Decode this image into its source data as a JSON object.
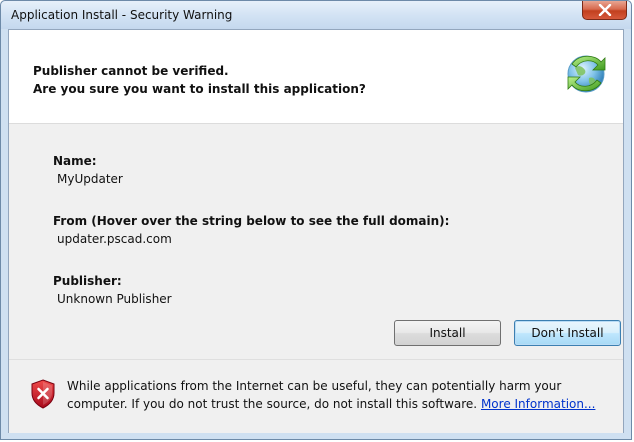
{
  "window": {
    "title": "Application Install - Security Warning"
  },
  "header": {
    "line1": "Publisher cannot be verified.",
    "line2": "Are you sure you want to install this application?"
  },
  "fields": {
    "name_label": "Name:",
    "name_value": "MyUpdater",
    "from_label": "From (Hover over the string below to see the full domain):",
    "from_value": "updater.pscad.com",
    "publisher_label": "Publisher:",
    "publisher_value": "Unknown Publisher"
  },
  "buttons": {
    "install": "Install",
    "dont_install": "Don't Install"
  },
  "warning": {
    "text": "While applications from the Internet can be useful, they can potentially harm your computer. If you do not trust the source, do not install this software.",
    "link": "More Information..."
  },
  "icons": {
    "close": "close-icon",
    "header": "globe-install-icon",
    "warning": "shield-warning-icon"
  },
  "colors": {
    "close_button": "#c2401f",
    "link": "#0033cc",
    "shield": "#c8102e"
  }
}
